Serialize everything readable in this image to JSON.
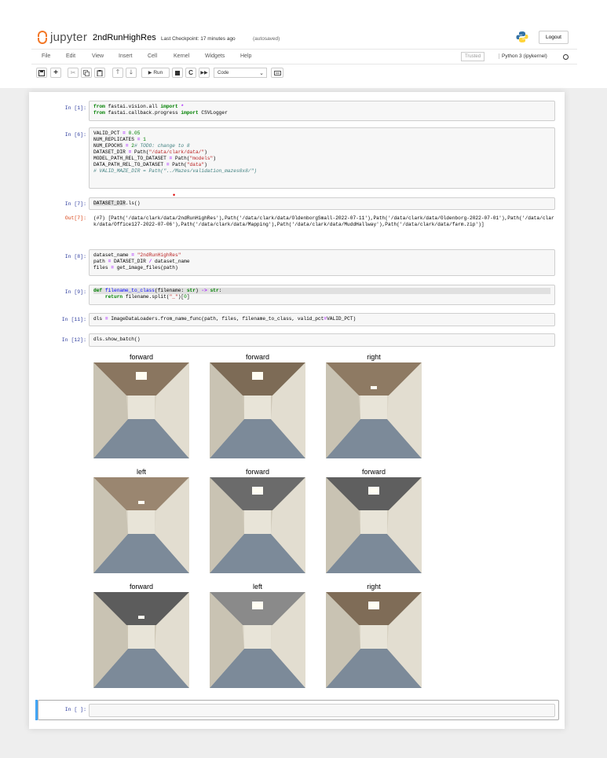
{
  "header": {
    "logo_text": "jupyter",
    "notebook_name": "2ndRunHighRes",
    "checkpoint": "Last Checkpoint: 17 minutes ago",
    "autosave": "(autosaved)",
    "logout_label": "Logout"
  },
  "menu": {
    "items": [
      "File",
      "Edit",
      "View",
      "Insert",
      "Cell",
      "Kernel",
      "Widgets",
      "Help"
    ],
    "trusted": "Trusted",
    "kernel": "Python 3 (ipykernel)"
  },
  "toolbar": {
    "run_label": "Run",
    "cell_type": "Code"
  },
  "cells": [
    {
      "prompt": "In [1]:",
      "lines": [
        "<span class='kw'>from</span> fastai.vision.all <span class='kw'>import</span> <span class='op'>*</span>",
        "<span class='kw'>from</span> fastai.callback.progress <span class='kw'>import</span> CSVLogger"
      ]
    },
    {
      "prompt": "In [6]:",
      "lines": [
        "VALID_PCT <span class='op'>=</span> <span class='num'>0.05</span>",
        "NUM_REPLICATES <span class='op'>=</span> <span class='num'>1</span>",
        "NUM_EPOCHS <span class='op'>=</span> <span class='num'>2</span><span class='cm'># TODO: change to 8</span>",
        "DATASET_DIR <span class='op'>=</span> Path(<span class='str'>\"/data/clark/data/\"</span>)",
        "MODEL_PATH_REL_TO_DATASET <span class='op'>=</span> Path(<span class='str'>\"models\"</span>)",
        "DATA_PATH_REL_TO_DATASET <span class='op'>=</span> Path(<span class='str'>\"data\"</span>)",
        "<span class='cm'># VALID_MAZE_DIR = Path(\"../Mazes/validation_mazes8x8/\")</span>"
      ]
    },
    {
      "prompt": "In [7]:",
      "lines": [
        "<span class='hl'>DATASET_DIR</span>.ls()"
      ]
    },
    {
      "prompt": "In [8]:",
      "lines": [
        "dataset_name <span class='op'>=</span> <span class='str'>\"2ndRunHighRes\"</span>",
        "path <span class='op'>=</span> DATASET_DIR <span class='op'>/</span> dataset_name",
        "files <span class='op'>=</span> get_image_files(path)"
      ]
    },
    {
      "prompt": "In [9]:",
      "lines": [
        "<span class='kw'>def</span> <span class='fn'>filename_to_class</span>(filename: <span class='kw'>str</span>) <span class='op'>-></span> <span class='kw'>str</span>:",
        "    <span class='kw'>return</span> filename.split(<span class='str'>\"_\"</span>)[<span class='num'>0</span>]"
      ]
    },
    {
      "prompt": "In [11]:",
      "lines": [
        "dls <span class='op'>=</span> ImageDataLoaders.from_name_func(path, files, filename_to_class, valid_pct<span class='op'>=</span>VALID_PCT)"
      ]
    },
    {
      "prompt": "In [12]:",
      "lines": [
        "dls.show_batch()"
      ]
    }
  ],
  "out7": {
    "prompt": "Out[7]:",
    "text": "(#7) [Path('/data/clark/data/2ndRunHighRes'),Path('/data/clark/data/OldenborgSmall-2022-07-11'),Path('/data/clark/data/Oldenborg-2022-07-01'),Path('/data/clark/data/Office127-2022-07-06'),Path('/data/clark/data/Mapping'),Path('/data/clark/data/MuddHallway'),Path('/data/clark/data/farm.zip')]"
  },
  "batch_labels": [
    "forward",
    "forward",
    "right",
    "left",
    "forward",
    "forward",
    "forward",
    "left",
    "right"
  ],
  "empty_cell_prompt": "In [ ]:"
}
